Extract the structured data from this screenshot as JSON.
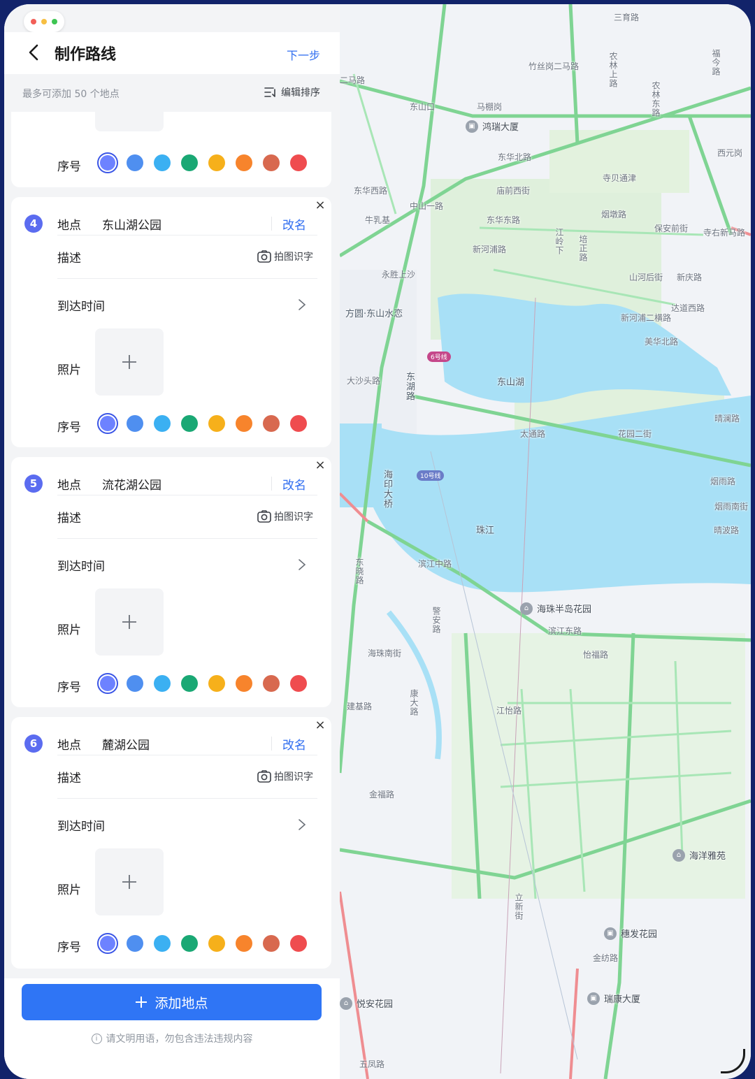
{
  "header": {
    "title": "制作路线",
    "next_label": "下一步"
  },
  "subbar": {
    "hint": "最多可添加 50 个地点",
    "edit_order_label": "编辑排序"
  },
  "labels": {
    "place": "地点",
    "description": "描述",
    "arrival_time": "到达时间",
    "photo": "照片",
    "order": "序号",
    "rename": "改名",
    "ocr": "拍图识字",
    "close": "×"
  },
  "colors": {
    "accent": "#2f6df0",
    "swatches": [
      "#6d82ff",
      "#4f8ff0",
      "#3bb0f2",
      "#1aa874",
      "#f6b01b",
      "#f7842c",
      "#d8694f",
      "#ef4c4f"
    ]
  },
  "stops": [
    {
      "number": "4",
      "place": "东山湖公园",
      "selected_swatch": 0
    },
    {
      "number": "5",
      "place": "流花湖公园",
      "selected_swatch": 0
    },
    {
      "number": "6",
      "place": "麓湖公园",
      "selected_swatch": 0
    }
  ],
  "footer": {
    "add_label": "添加地点",
    "legal": "请文明用语，勿包含违法违规内容"
  },
  "map": {
    "pois": [
      "鸿瑞大厦",
      "海珠半岛花园",
      "海洋雅苑",
      "穗发花园",
      "瑞康大厦",
      "悦安花园"
    ],
    "areas": [
      "东山湖",
      "珠江",
      "方圆·东山水恋"
    ],
    "metro": [
      "6号线",
      "10号线"
    ],
    "roads": [
      "三育路",
      "竹丝岗二马路",
      "农林上路",
      "农林东路",
      "福今路",
      "东山口",
      "马棚岗",
      "东华北路",
      "庙前西街",
      "寺贝通津",
      "烟墩路",
      "保安前街",
      "寺右新马路",
      "中山一路",
      "新河浦路",
      "东华东路",
      "培正路",
      "江岭下",
      "山河后街",
      "新庆路",
      "达道西路",
      "新河浦二横路",
      "美华北路",
      "东湖路",
      "大沙头路",
      "海印大桥",
      "花园二街",
      "太通路",
      "烟雨路",
      "晴波路",
      "东晓路",
      "滨江中路",
      "滨江东路",
      "怡福路",
      "江怡路",
      "金福路",
      "金纺路",
      "立新街",
      "五凤路",
      "西元岗",
      "永胜上沙",
      "牛乳基",
      "东华西路",
      "二马路",
      "晴澜路",
      "烟雨南街",
      "建基路",
      "海珠南街",
      "康大路",
      "警安路"
    ]
  }
}
